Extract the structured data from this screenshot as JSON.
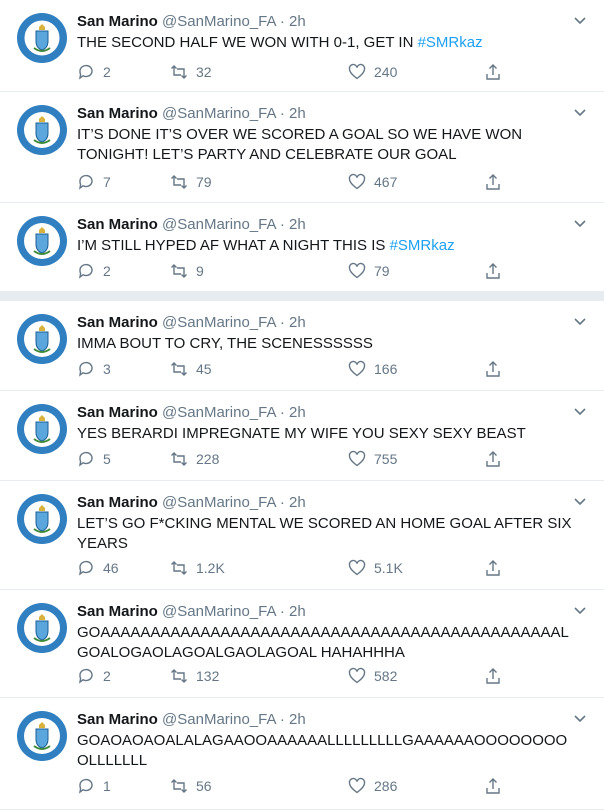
{
  "account": {
    "name": "San Marino",
    "handle": "@SanMarino_FA",
    "time_sep": "·"
  },
  "colors": {
    "accent": "#1da1f2",
    "muted": "#657786",
    "text": "#14171a",
    "border": "#e6ecf0"
  },
  "icons": {
    "reply": "reply-icon",
    "retweet": "retweet-icon",
    "like": "heart-icon",
    "share": "share-icon",
    "menu": "chevron-down-icon"
  },
  "tweets": [
    {
      "time": "2h",
      "text": "THE SECOND HALF WE WON WITH 0-1, GET IN ",
      "hashtag": "#SMRkaz",
      "replies": "2",
      "retweets": "32",
      "likes": "240"
    },
    {
      "time": "2h",
      "text": "IT’S DONE IT’S OVER WE SCORED A GOAL SO WE HAVE WON TONIGHT! LET’S PARTY AND CELEBRATE OUR GOAL",
      "hashtag": "",
      "replies": "7",
      "retweets": "79",
      "likes": "467"
    },
    {
      "time": "2h",
      "text": "I’M STILL HYPED AF WHAT A NIGHT THIS IS ",
      "hashtag": "#SMRkaz",
      "replies": "2",
      "retweets": "9",
      "likes": "79"
    },
    {
      "time": "2h",
      "text": "IMMA BOUT TO CRY, THE SCENESSSSSS",
      "hashtag": "",
      "replies": "3",
      "retweets": "45",
      "likes": "166"
    },
    {
      "time": "2h",
      "text": "YES BERARDI IMPREGNATE MY WIFE YOU SEXY SEXY BEAST",
      "hashtag": "",
      "replies": "5",
      "retweets": "228",
      "likes": "755"
    },
    {
      "time": "2h",
      "text": "LET’S GO F*CKING MENTAL WE SCORED AN HOME GOAL AFTER SIX YEARS",
      "hashtag": "",
      "replies": "46",
      "retweets": "1.2K",
      "likes": "5.1K"
    },
    {
      "time": "2h",
      "text": "GOAAAAAAAAAAAAAAAAAAAAAAAAAAAAAAAAAAAAAAAAAAAAAAL GOALOGAOLAGOALGAOLAGOAL HAHAHHHA",
      "hashtag": "",
      "replies": "2",
      "retweets": "132",
      "likes": "582"
    },
    {
      "time": "2h",
      "text": "GOAOAOAOALALAGAAOOAAAAAALLLLLLLLLGAAAAAAOOOOOOOO OLLLLLLL",
      "hashtag": "",
      "replies": "1",
      "retweets": "56",
      "likes": "286"
    }
  ]
}
